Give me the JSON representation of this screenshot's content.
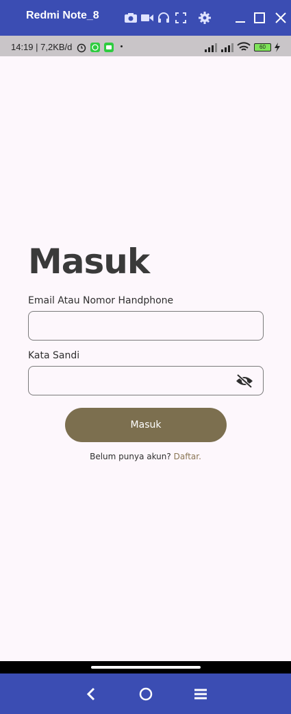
{
  "window": {
    "title": "Redmi Note_8",
    "icons": [
      "camera-icon",
      "video-icon",
      "headphones-icon",
      "fullscreen-icon",
      "settings-icon",
      "minimize-icon",
      "maximize-icon",
      "close-icon"
    ]
  },
  "status_bar": {
    "time_speed": "14:19 | 7,2KB/d",
    "battery": "60"
  },
  "login": {
    "title": "Masuk",
    "email_label": "Email Atau Nomor Handphone",
    "email_value": "",
    "password_label": "Kata Sandi",
    "password_value": "",
    "submit_label": "Masuk",
    "signup_prompt": "Belum punya akun?",
    "signup_link": "Daftar."
  },
  "colors": {
    "accent": "#7c6f4f",
    "window_bar": "#3b4db3",
    "background": "#fdf7fc"
  }
}
